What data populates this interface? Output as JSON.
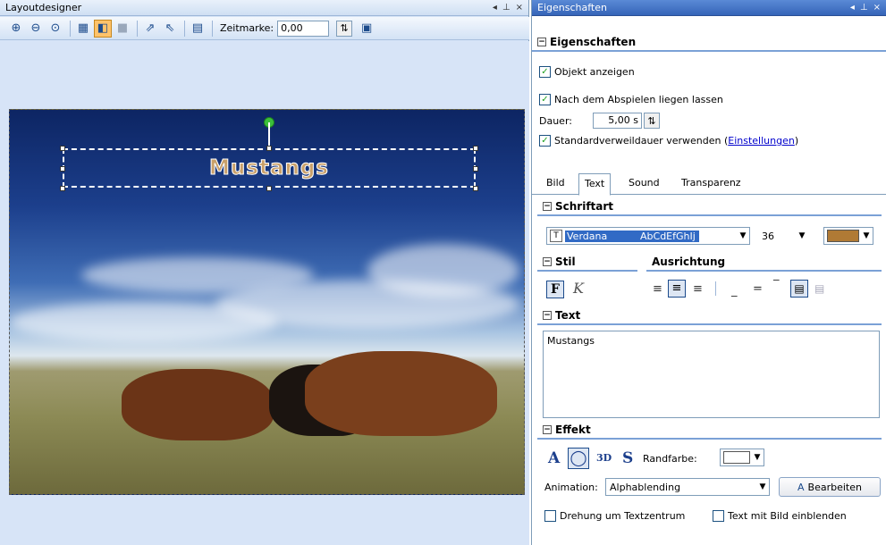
{
  "left_panel": {
    "title": "Layoutdesigner",
    "controls": [
      "◂",
      "⊥",
      "×"
    ],
    "toolbar": {
      "zeitmarke_label": "Zeitmarke:",
      "zeitmarke_value": "0,00"
    },
    "canvas_text": "Mustangs"
  },
  "right_panel": {
    "title": "Eigenschaften",
    "controls": [
      "◂",
      "⊥",
      "×"
    ],
    "section_eigenschaften": "Eigenschaften",
    "objekt_anzeigen": "Objekt anzeigen",
    "nach_abspielen": "Nach dem Abspielen liegen lassen",
    "dauer_label": "Dauer:",
    "dauer_value": "5,00 s",
    "standard_label": "Standardverweildauer verwenden (",
    "standard_link": "Einstellungen",
    "standard_close": ")",
    "tabs": [
      "Bild",
      "Text",
      "Sound",
      "Transparenz"
    ],
    "section_schriftart": "Schriftart",
    "font_name": "Verdana",
    "font_preview": "AbCdEfGhIj",
    "font_size": "36",
    "section_stil": "Stil",
    "label_ausrichtung": "Ausrichtung",
    "bold_glyph": "F",
    "italic_glyph": "K",
    "section_text": "Text",
    "text_value": "Mustangs",
    "section_effekt": "Effekt",
    "effect_a": "A",
    "effect_3d": "3D",
    "effect_s": "S",
    "randfarbe_label": "Randfarbe:",
    "animation_label": "Animation:",
    "animation_value": "Alphablending",
    "bearbeiten_label": "Bearbeiten",
    "drehung_label": "Drehung um Textzentrum",
    "text_mit_bild_label": "Text mit Bild einblenden"
  },
  "colors": {
    "font_color": "#b07a35",
    "accent": "#3564b8"
  }
}
